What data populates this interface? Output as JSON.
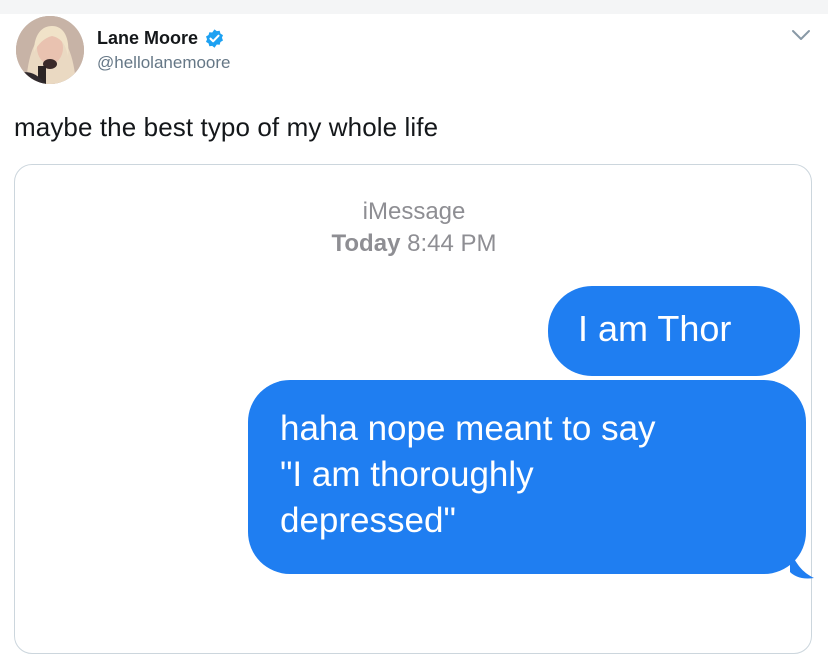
{
  "tweet": {
    "author_name": "Lane Moore",
    "author_handle": "@hellolanemoore",
    "verified_icon": "verified-badge-icon",
    "menu_icon": "chevron-down-icon",
    "text": "maybe the best typo of my whole life"
  },
  "imessage": {
    "service_label": "iMessage",
    "timestamp_day": "Today",
    "timestamp_time": "8:44 PM",
    "messages": [
      {
        "lines": [
          "I am Thor"
        ]
      },
      {
        "lines": [
          "haha nope meant to say",
          "\"I am thoroughly",
          "depressed\""
        ]
      }
    ],
    "bubble_color": "#1f7ef1"
  },
  "colors": {
    "verified": "#1da1f2",
    "handle": "#657786",
    "text": "#14171a",
    "card_border": "#ccd6dd"
  }
}
